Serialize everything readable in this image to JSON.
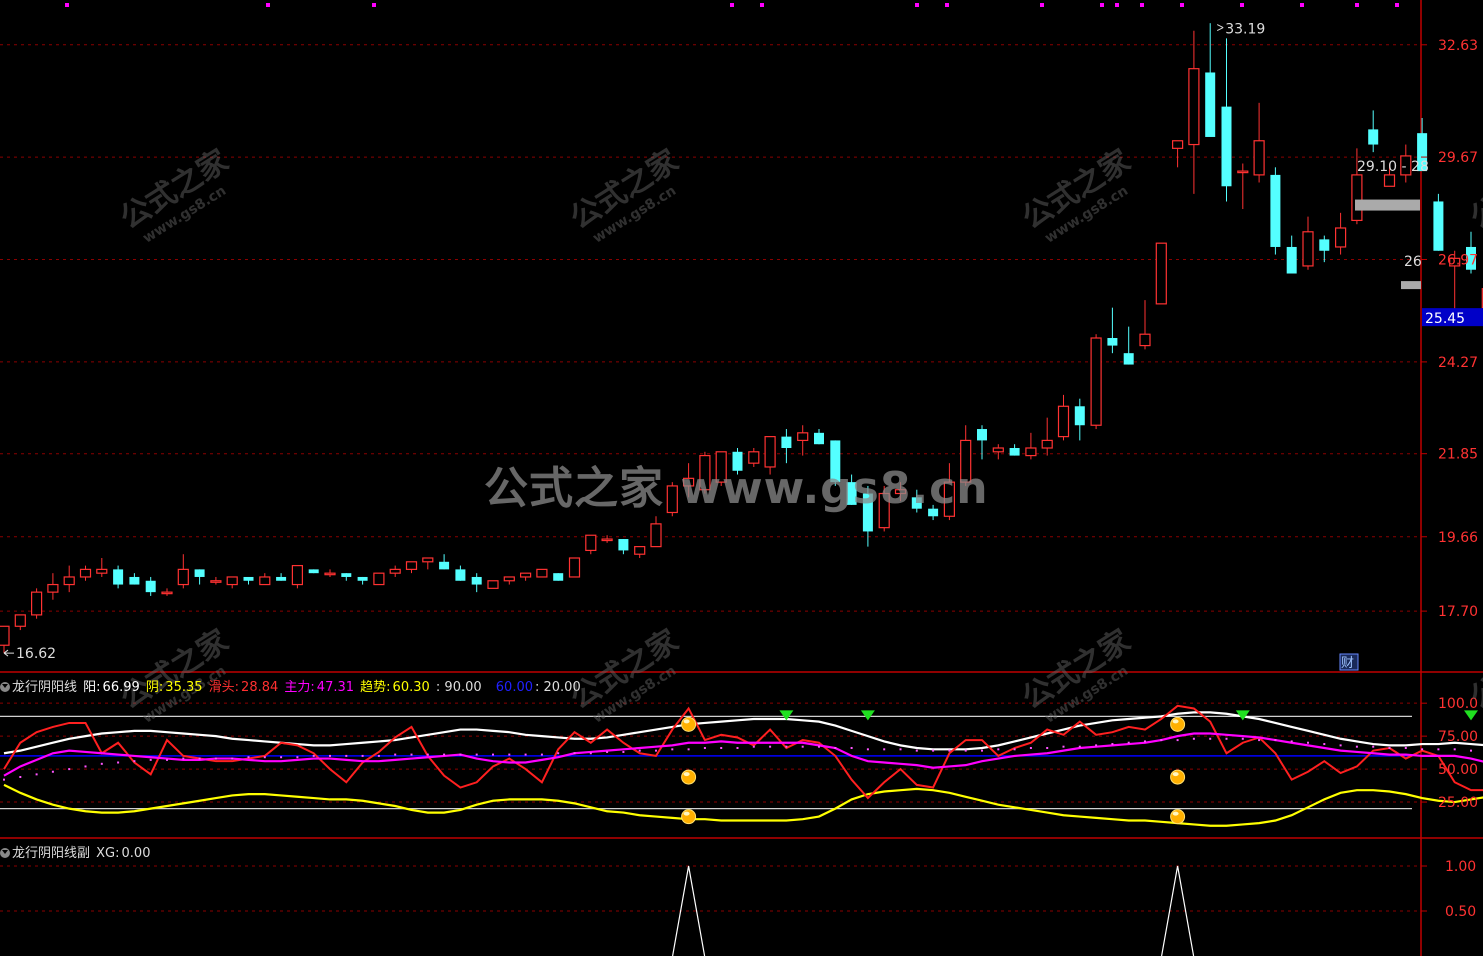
{
  "colors": {
    "up": "#ff3232",
    "down": "#54ffff",
    "grid": "#8b0000",
    "axis": "#c00000",
    "priceLabel": "#ff3232",
    "yang": "#ffffff",
    "yin": "#ffff00",
    "huatou": "#ff2020",
    "zhuli": "#ff00ff",
    "qushi": "#ffff00",
    "line60": "#0000ff",
    "last_bg": "#0000c8"
  },
  "main_axis": {
    "ticks": [
      "32.63",
      "29.67",
      "26.97",
      "24.27",
      "21.85",
      "19.66",
      "17.70"
    ],
    "last_price": "25.45",
    "high_label": "33.19",
    "low_label": "16.62",
    "range_label_1": "29.10 - 28",
    "range_label_2": "26",
    "cai_badge": "财"
  },
  "indicator1": {
    "name": "龙行阴阳线",
    "yang_label": "阳:",
    "yang_value": "66.99",
    "yin_label": "阴:",
    "yin_value": "35.35",
    "huatou_label": "滑头:",
    "huatou_value": "28.84",
    "zhuli_label": "主力:",
    "zhuli_value": "47.31",
    "qushi_label": "趋势:",
    "qushi_value": "60.30",
    "c90": ": 90.00",
    "c60": "60.00",
    "c20": ": 20.00",
    "ticks": [
      "100.0",
      "75.00",
      "50.00",
      "25.00"
    ]
  },
  "indicator2": {
    "name": "龙行阴阳线副",
    "xg_label": "XG:",
    "xg_value": "0.00",
    "ticks": [
      "1.00",
      "0.50"
    ]
  },
  "watermark": {
    "big": "公式之家 www.gs8.cn",
    "small_a": "公式之家",
    "small_b": "www.gs8.cn"
  },
  "chart_data": [
    {
      "type": "candlestick",
      "ylim": [
        16.2,
        33.6
      ],
      "y_ticks": [
        32.63,
        29.67,
        26.97,
        24.27,
        21.85,
        19.66,
        17.7
      ],
      "high": 33.19,
      "low": 16.62,
      "last": 25.45,
      "candles": [
        [
          16.8,
          17.3,
          16.6,
          17.3
        ],
        [
          17.3,
          17.6,
          17.2,
          17.6
        ],
        [
          17.6,
          18.3,
          17.5,
          18.2
        ],
        [
          18.2,
          18.7,
          18.0,
          18.4
        ],
        [
          18.4,
          18.9,
          18.2,
          18.6
        ],
        [
          18.6,
          18.9,
          18.5,
          18.8
        ],
        [
          18.7,
          19.1,
          18.6,
          18.8
        ],
        [
          18.8,
          18.9,
          18.3,
          18.4
        ],
        [
          18.6,
          18.7,
          18.4,
          18.4
        ],
        [
          18.5,
          18.6,
          18.1,
          18.2
        ],
        [
          18.2,
          18.3,
          18.1,
          18.2
        ],
        [
          18.4,
          19.2,
          18.3,
          18.8
        ],
        [
          18.8,
          18.8,
          18.4,
          18.6
        ],
        [
          18.5,
          18.6,
          18.4,
          18.5
        ],
        [
          18.4,
          18.6,
          18.3,
          18.6
        ],
        [
          18.6,
          18.6,
          18.4,
          18.5
        ],
        [
          18.4,
          18.7,
          18.4,
          18.6
        ],
        [
          18.6,
          18.7,
          18.5,
          18.5
        ],
        [
          18.4,
          18.9,
          18.3,
          18.9
        ],
        [
          18.8,
          18.8,
          18.7,
          18.7
        ],
        [
          18.7,
          18.8,
          18.6,
          18.7
        ],
        [
          18.7,
          18.7,
          18.5,
          18.6
        ],
        [
          18.6,
          18.6,
          18.4,
          18.5
        ],
        [
          18.4,
          18.7,
          18.4,
          18.7
        ],
        [
          18.7,
          18.9,
          18.6,
          18.8
        ],
        [
          18.8,
          19.0,
          18.7,
          19.0
        ],
        [
          19.0,
          19.1,
          18.8,
          19.1
        ],
        [
          19.0,
          19.2,
          18.8,
          18.8
        ],
        [
          18.8,
          18.9,
          18.5,
          18.5
        ],
        [
          18.6,
          18.7,
          18.2,
          18.4
        ],
        [
          18.3,
          18.5,
          18.3,
          18.5
        ],
        [
          18.5,
          18.6,
          18.4,
          18.6
        ],
        [
          18.6,
          18.7,
          18.5,
          18.7
        ],
        [
          18.6,
          18.8,
          18.6,
          18.8
        ],
        [
          18.7,
          18.7,
          18.5,
          18.5
        ],
        [
          18.6,
          19.1,
          18.6,
          19.1
        ],
        [
          19.3,
          19.7,
          19.2,
          19.7
        ],
        [
          19.6,
          19.7,
          19.5,
          19.6
        ],
        [
          19.6,
          19.6,
          19.2,
          19.3
        ],
        [
          19.2,
          19.4,
          19.1,
          19.4
        ],
        [
          19.4,
          20.2,
          19.4,
          20.0
        ],
        [
          20.3,
          21.1,
          20.2,
          21.0
        ],
        [
          21.0,
          21.6,
          20.7,
          21.2
        ],
        [
          20.9,
          21.9,
          20.8,
          21.8
        ],
        [
          21.1,
          21.9,
          21.0,
          21.9
        ],
        [
          21.9,
          22.0,
          21.3,
          21.4
        ],
        [
          21.6,
          22.0,
          21.5,
          21.9
        ],
        [
          21.5,
          22.3,
          21.3,
          22.3
        ],
        [
          22.3,
          22.5,
          21.6,
          22.0
        ],
        [
          22.2,
          22.6,
          21.8,
          22.4
        ],
        [
          22.4,
          22.5,
          22.1,
          22.1
        ],
        [
          22.2,
          22.2,
          21.0,
          21.1
        ],
        [
          21.1,
          21.3,
          20.5,
          20.5
        ],
        [
          20.8,
          21.0,
          19.4,
          19.8
        ],
        [
          19.9,
          21.0,
          19.8,
          20.8
        ],
        [
          20.8,
          21.1,
          20.6,
          20.9
        ],
        [
          20.7,
          20.9,
          20.3,
          20.4
        ],
        [
          20.4,
          20.5,
          20.1,
          20.2
        ],
        [
          20.2,
          21.6,
          20.1,
          21.1
        ],
        [
          21.1,
          22.6,
          21.0,
          22.2
        ],
        [
          22.5,
          22.6,
          21.7,
          22.2
        ],
        [
          21.9,
          22.1,
          21.7,
          22.0
        ],
        [
          22.0,
          22.1,
          21.8,
          21.8
        ],
        [
          21.8,
          22.4,
          21.7,
          22.0
        ],
        [
          22.0,
          22.8,
          21.8,
          22.2
        ],
        [
          22.3,
          23.4,
          22.2,
          23.1
        ],
        [
          23.1,
          23.3,
          22.2,
          22.6
        ],
        [
          22.6,
          25.0,
          22.5,
          24.9
        ],
        [
          24.9,
          25.7,
          24.5,
          24.7
        ],
        [
          24.5,
          25.2,
          24.2,
          24.2
        ],
        [
          24.7,
          25.9,
          24.6,
          25.0
        ],
        [
          25.8,
          27.4,
          25.8,
          27.4
        ],
        [
          29.9,
          30.1,
          29.4,
          30.1
        ],
        [
          30.0,
          33.0,
          28.7,
          32.0
        ],
        [
          31.9,
          33.2,
          31.2,
          30.2
        ],
        [
          31.0,
          32.8,
          28.5,
          28.9
        ],
        [
          29.3,
          29.5,
          28.3,
          29.3
        ],
        [
          29.2,
          31.1,
          29.0,
          30.1
        ],
        [
          29.2,
          29.4,
          27.1,
          27.3
        ],
        [
          27.3,
          27.6,
          26.8,
          26.6
        ],
        [
          26.8,
          28.1,
          26.7,
          27.7
        ],
        [
          27.5,
          27.6,
          26.9,
          27.2
        ],
        [
          27.3,
          28.2,
          27.1,
          27.8
        ],
        [
          28.0,
          29.9,
          27.9,
          29.2
        ],
        [
          30.4,
          30.9,
          29.8,
          30.0
        ],
        [
          28.9,
          29.5,
          28.9,
          29.2
        ],
        [
          29.2,
          30.0,
          29.0,
          29.7
        ],
        [
          30.3,
          30.7,
          29.5,
          29.3
        ],
        [
          28.5,
          28.7,
          27.2,
          27.2
        ],
        [
          26.8,
          27.2,
          25.5,
          27.0
        ],
        [
          27.3,
          27.7,
          26.6,
          26.7
        ],
        [
          25.7,
          26.4,
          25.4,
          26.2
        ]
      ]
    },
    {
      "type": "line",
      "ylim": [
        0,
        110
      ],
      "y_ticks": [
        100,
        75,
        50,
        25
      ],
      "reference_lines": [
        90,
        60,
        20
      ],
      "series": [
        {
          "name": "阳",
          "values": [
            62,
            64,
            67,
            70,
            73,
            75,
            77,
            78,
            79,
            79,
            78,
            77,
            76,
            75,
            73,
            72,
            71,
            70,
            69,
            68,
            68,
            69,
            70,
            71,
            72,
            74,
            76,
            78,
            80,
            80,
            79,
            78,
            76,
            75,
            74,
            73,
            73,
            74,
            76,
            78,
            80,
            82,
            84,
            85,
            86,
            87,
            88,
            88,
            88,
            87,
            86,
            83,
            79,
            75,
            71,
            68,
            66,
            65,
            65,
            65,
            66,
            68,
            71,
            74,
            77,
            80,
            83,
            85,
            87,
            88,
            89,
            90,
            92,
            93,
            93,
            92,
            90,
            88,
            85,
            82,
            79,
            76,
            73,
            71,
            69,
            68,
            68,
            69,
            69,
            70,
            69,
            68,
            67,
            66
          ]
        },
        {
          "name": "阴",
          "values": [
            38,
            32,
            27,
            23,
            20,
            18,
            17,
            17,
            18,
            20,
            22,
            24,
            26,
            28,
            30,
            31,
            31,
            30,
            29,
            28,
            27,
            27,
            26,
            24,
            22,
            19,
            17,
            17,
            19,
            23,
            26,
            27,
            27,
            27,
            26,
            24,
            21,
            18,
            17,
            15,
            14,
            13,
            12,
            12,
            11,
            11,
            11,
            11,
            11,
            12,
            14,
            20,
            27,
            31,
            33,
            34,
            35,
            34,
            32,
            29,
            26,
            23,
            21,
            19,
            17,
            15,
            14,
            13,
            12,
            11,
            11,
            10,
            9,
            8,
            7,
            7,
            8,
            9,
            11,
            15,
            21,
            27,
            32,
            34,
            34,
            33,
            31,
            28,
            26,
            25,
            27,
            29,
            32,
            35
          ]
        },
        {
          "name": "滑头",
          "values": [
            50,
            70,
            78,
            82,
            85,
            85,
            62,
            70,
            55,
            46,
            72,
            60,
            58,
            56,
            56,
            58,
            60,
            70,
            68,
            62,
            50,
            40,
            55,
            63,
            74,
            82,
            60,
            45,
            36,
            40,
            52,
            58,
            50,
            40,
            65,
            78,
            70,
            80,
            70,
            62,
            60,
            80,
            96,
            72,
            76,
            74,
            68,
            80,
            66,
            72,
            70,
            60,
            42,
            28,
            40,
            50,
            38,
            36,
            62,
            72,
            72,
            60,
            66,
            70,
            80,
            76,
            86,
            76,
            78,
            82,
            80,
            88,
            98,
            96,
            86,
            62,
            70,
            74,
            62,
            42,
            48,
            56,
            47,
            52,
            64,
            66,
            58,
            64,
            60,
            40,
            34,
            34,
            32,
            28
          ]
        },
        {
          "name": "主力",
          "values": [
            45,
            52,
            57,
            62,
            64,
            63,
            62,
            61,
            60,
            59,
            58,
            57,
            57,
            58,
            58,
            57,
            56,
            56,
            57,
            58,
            58,
            57,
            56,
            56,
            57,
            58,
            59,
            60,
            61,
            58,
            56,
            55,
            55,
            57,
            59,
            62,
            63,
            64,
            65,
            66,
            67,
            68,
            70,
            70,
            71,
            70,
            70,
            70,
            70,
            70,
            68,
            66,
            60,
            56,
            55,
            54,
            53,
            51,
            52,
            53,
            56,
            58,
            60,
            61,
            62,
            64,
            66,
            67,
            68,
            69,
            70,
            72,
            75,
            77,
            77,
            76,
            75,
            74,
            72,
            70,
            68,
            66,
            64,
            63,
            62,
            61,
            61,
            60,
            60,
            60,
            58,
            55,
            51,
            47
          ]
        },
        {
          "name": "趋势",
          "values": [
            42,
            44,
            46,
            48,
            50,
            52,
            54,
            55,
            56,
            57,
            57,
            58,
            58,
            58,
            58,
            59,
            59,
            59,
            59,
            60,
            60,
            60,
            60,
            60,
            61,
            61,
            61,
            61,
            61,
            61,
            61,
            61,
            61,
            61,
            62,
            62,
            62,
            63,
            63,
            64,
            64,
            65,
            65,
            66,
            66,
            66,
            67,
            67,
            67,
            67,
            67,
            66,
            66,
            65,
            65,
            65,
            64,
            64,
            64,
            64,
            64,
            65,
            65,
            66,
            66,
            67,
            67,
            68,
            69,
            70,
            71,
            72,
            72,
            73,
            73,
            73,
            73,
            72,
            72,
            71,
            70,
            69,
            68,
            67,
            67,
            66,
            66,
            65,
            65,
            65,
            64,
            64,
            63,
            62
          ]
        }
      ],
      "signal_indices": [
        42,
        72
      ],
      "sell_indices": [
        48,
        53,
        76,
        90
      ]
    },
    {
      "type": "line",
      "ylim": [
        0,
        1.2
      ],
      "y_ticks": [
        1.0,
        0.5
      ],
      "series": [
        {
          "name": "XG",
          "spike_indices": [
            42,
            72
          ]
        }
      ]
    }
  ]
}
